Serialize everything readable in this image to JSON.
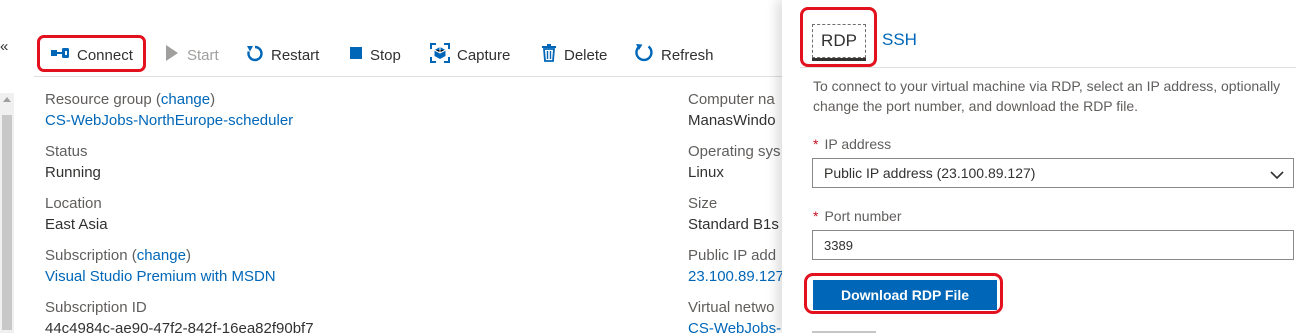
{
  "nav": {
    "collapse_glyph": "«"
  },
  "toolbar": {
    "connect": "Connect",
    "start": "Start",
    "restart": "Restart",
    "stop": "Stop",
    "capture": "Capture",
    "delete": "Delete",
    "refresh": "Refresh",
    "icons": [
      "connect-icon",
      "play-icon",
      "restart-icon",
      "stop-icon",
      "capture-icon",
      "trash-icon",
      "refresh-icon"
    ],
    "accent_color": "#0067b8",
    "disabled_color": "#a19f9d"
  },
  "essentials": {
    "resource_group": {
      "label": "Resource group",
      "paren_open": " (",
      "change": "change",
      "paren_close": ")",
      "value": "CS-WebJobs-NorthEurope-scheduler"
    },
    "status": {
      "label": "Status",
      "value": "Running"
    },
    "location": {
      "label": "Location",
      "value": "East Asia"
    },
    "subscription": {
      "label": "Subscription",
      "paren_open": " (",
      "change": "change",
      "paren_close": ")",
      "value": "Visual Studio Premium with MSDN"
    },
    "subscription_id": {
      "label": "Subscription ID",
      "value": "44c4984c-ae90-47f2-842f-16ea82f90bf7"
    },
    "computer_name": {
      "label": "Computer na",
      "value": "ManasWindo"
    },
    "operating_system": {
      "label": "Operating sys",
      "value": "Linux"
    },
    "size": {
      "label": "Size",
      "value": "Standard B1s"
    },
    "public_ip": {
      "label": "Public IP add",
      "value": "23.100.89.127"
    },
    "virtual_network": {
      "label": "Virtual netwo",
      "value": "CS-WebJobs-"
    }
  },
  "connect_blade": {
    "tabs": [
      {
        "label": "RDP",
        "selected": true
      },
      {
        "label": "SSH",
        "selected": false
      }
    ],
    "description": "To connect to your virtual machine via RDP, select an IP address, optionally change the port number, and download the RDP file.",
    "required_marker": "*",
    "ip_address": {
      "label": "IP address",
      "value": "Public IP address (23.100.89.127)"
    },
    "port_number": {
      "label": "Port number",
      "value": "3389"
    },
    "download_button": "Download RDP File",
    "highlight_color": "#e3101d",
    "button_color": "#0067b8"
  }
}
